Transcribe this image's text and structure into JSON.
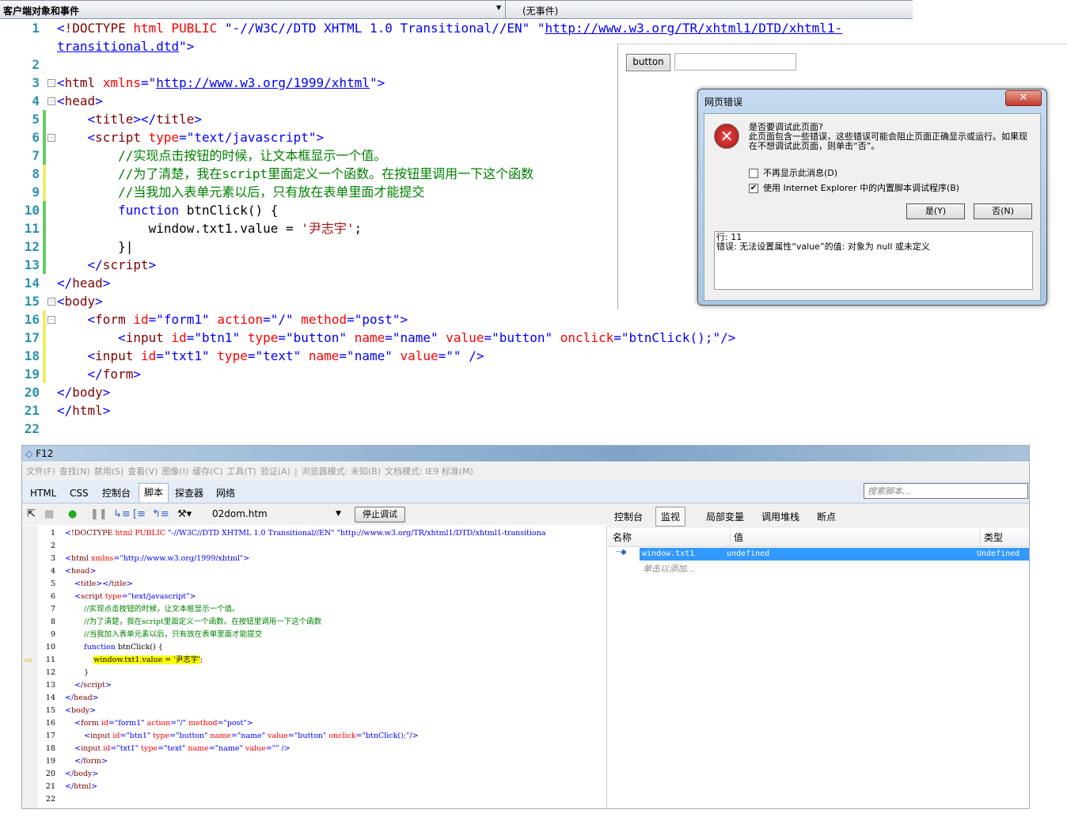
{
  "topbar": {
    "object_select": "客户端对象和事件",
    "event_select": "(无事件)"
  },
  "editor_lines": [
    {
      "n": "1",
      "tokens": [
        [
          "d",
          "<"
        ],
        [
          "tag",
          "!DOCTYPE "
        ],
        [
          "attr",
          "html PUBLIC "
        ],
        [
          "val",
          "\"-//W3C//DTD XHTML 1.0 Transitional//EN\" \""
        ],
        [
          "link",
          "http://www.w3.org/TR/xhtml1/DTD/xhtml1-"
        ]
      ]
    },
    {
      "n": "",
      "tokens": [
        [
          "link",
          "transitional.dtd"
        ],
        [
          "val",
          "\""
        ],
        [
          "d",
          ">"
        ]
      ]
    },
    {
      "n": "2",
      "tokens": []
    },
    {
      "n": "3",
      "fold": "-",
      "tokens": [
        [
          "d",
          "<"
        ],
        [
          "tag",
          "html "
        ],
        [
          "attr",
          "xmlns"
        ],
        [
          "d",
          "=\""
        ],
        [
          "link",
          "http://www.w3.org/1999/xhtml"
        ],
        [
          "d",
          "\">"
        ]
      ]
    },
    {
      "n": "4",
      "fold": "-",
      "tokens": [
        [
          "d",
          "<"
        ],
        [
          "tag",
          "head"
        ],
        [
          "d",
          ">"
        ]
      ]
    },
    {
      "n": "5",
      "chg": "#6c6",
      "tokens": [
        [
          "txt",
          "    "
        ],
        [
          "d",
          "<"
        ],
        [
          "tag",
          "title"
        ],
        [
          "d",
          "></"
        ],
        [
          "tag",
          "title"
        ],
        [
          "d",
          ">"
        ]
      ]
    },
    {
      "n": "6",
      "chg": "#6c6",
      "fold": "-",
      "tokens": [
        [
          "txt",
          "    "
        ],
        [
          "d",
          "<"
        ],
        [
          "tag",
          "script "
        ],
        [
          "attr",
          "type"
        ],
        [
          "d",
          "=\"text/javascript\">"
        ]
      ]
    },
    {
      "n": "7",
      "chg": "#6c6",
      "tokens": [
        [
          "txt",
          "        "
        ],
        [
          "com",
          "//实现点击按钮的时候，让文本框显示一个值。"
        ]
      ]
    },
    {
      "n": "8",
      "chg": "#ee6",
      "tokens": [
        [
          "txt",
          "        "
        ],
        [
          "com",
          "//为了清楚，我在script里面定义一个函数。在按钮里调用一下这个函数"
        ]
      ]
    },
    {
      "n": "9",
      "chg": "#ee6",
      "tokens": [
        [
          "txt",
          "        "
        ],
        [
          "com",
          "//当我加入表单元素以后，只有放在表单里面才能提交"
        ]
      ]
    },
    {
      "n": "10",
      "chg": "#6c6",
      "tokens": [
        [
          "txt",
          "        "
        ],
        [
          "kw",
          "function "
        ],
        [
          "txt",
          "btnClick() {"
        ]
      ]
    },
    {
      "n": "11",
      "chg": "#6c6",
      "tokens": [
        [
          "txt",
          "            window.txt1.value = "
        ],
        [
          "str",
          "'尹志宇'"
        ],
        [
          "txt",
          ";"
        ]
      ]
    },
    {
      "n": "12",
      "chg": "#6c6",
      "tokens": [
        [
          "txt",
          "        }|"
        ]
      ]
    },
    {
      "n": "13",
      "chg": "#6c6",
      "tokens": [
        [
          "txt",
          "    "
        ],
        [
          "d",
          "</"
        ],
        [
          "tag",
          "script"
        ],
        [
          "d",
          ">"
        ]
      ]
    },
    {
      "n": "14",
      "tokens": [
        [
          "d",
          "</"
        ],
        [
          "tag",
          "head"
        ],
        [
          "d",
          ">"
        ]
      ]
    },
    {
      "n": "15",
      "fold": "-",
      "tokens": [
        [
          "d",
          "<"
        ],
        [
          "tag",
          "body"
        ],
        [
          "d",
          ">"
        ]
      ]
    },
    {
      "n": "16",
      "chg": "#ee6",
      "fold": "-",
      "tokens": [
        [
          "txt",
          "    "
        ],
        [
          "d",
          "<"
        ],
        [
          "tag",
          "form "
        ],
        [
          "attr",
          "id"
        ],
        [
          "d",
          "=\"form1\" "
        ],
        [
          "attr",
          "action"
        ],
        [
          "d",
          "=\"/\" "
        ],
        [
          "attr",
          "method"
        ],
        [
          "d",
          "=\"post\">"
        ]
      ]
    },
    {
      "n": "17",
      "chg": "#ee6",
      "tokens": [
        [
          "txt",
          "        "
        ],
        [
          "d",
          "<"
        ],
        [
          "tag",
          "input "
        ],
        [
          "attr",
          "id"
        ],
        [
          "d",
          "=\"btn1\" "
        ],
        [
          "attr",
          "type"
        ],
        [
          "d",
          "=\"button\" "
        ],
        [
          "attr",
          "name"
        ],
        [
          "d",
          "=\"name\" "
        ],
        [
          "attr",
          "value"
        ],
        [
          "d",
          "=\"button\" "
        ],
        [
          "attr",
          "onclick"
        ],
        [
          "d",
          "=\"btnClick();\"/>"
        ]
      ]
    },
    {
      "n": "18",
      "chg": "#ee6",
      "tokens": [
        [
          "txt",
          "    "
        ],
        [
          "d",
          "<"
        ],
        [
          "tag",
          "input "
        ],
        [
          "attr",
          "id"
        ],
        [
          "d",
          "=\"txt1\" "
        ],
        [
          "attr",
          "type"
        ],
        [
          "d",
          "=\"text\" "
        ],
        [
          "attr",
          "name"
        ],
        [
          "d",
          "=\"name\" "
        ],
        [
          "attr",
          "value"
        ],
        [
          "d",
          "=\"\" />"
        ]
      ]
    },
    {
      "n": "19",
      "chg": "#ee6",
      "tokens": [
        [
          "txt",
          "    "
        ],
        [
          "d",
          "</"
        ],
        [
          "tag",
          "form"
        ],
        [
          "d",
          ">"
        ]
      ]
    },
    {
      "n": "20",
      "tokens": [
        [
          "d",
          "</"
        ],
        [
          "tag",
          "body"
        ],
        [
          "d",
          ">"
        ]
      ]
    },
    {
      "n": "21",
      "tokens": [
        [
          "d",
          "</"
        ],
        [
          "tag",
          "html"
        ],
        [
          "d",
          ">"
        ]
      ]
    },
    {
      "n": "22",
      "tokens": []
    }
  ],
  "preview": {
    "button_label": "button",
    "textbox_value": ""
  },
  "dialog": {
    "title": "网页错误",
    "close": "✕",
    "icon": "error-icon",
    "message": "是否要调试此页面?\n此页面包含一些错误，这些错误可能会阻止页面正确显示或运行。如果现在不想调试此页面，则单击“否”。",
    "checkbox1": "不再显示此消息(D)",
    "checkbox1_checked": false,
    "checkbox2": "使用 Internet Explorer 中的内置脚本调试程序(B)",
    "checkbox2_checked": true,
    "yes": "是(Y)",
    "no": "否(N)",
    "log_line": "行: 11",
    "log_error": "错误: 无法设置属性“value”的值: 对象为 null 或未定义"
  },
  "f12": {
    "title": "F12",
    "menu": [
      "文件(F)",
      "查找(N)",
      "禁用(S)",
      "查看(V)",
      "图像(I)",
      "缓存(C)",
      "工具(T)",
      "验证(A)",
      "|",
      "浏览器模式: 未知(B)",
      "文档模式: IE9 标准(M)"
    ],
    "tabs": [
      "HTML",
      "CSS",
      "控制台",
      "脚本",
      "探查器",
      "网络"
    ],
    "active_tab": "脚本",
    "search_placeholder": "搜索脚本...",
    "file": "02dom.htm",
    "stop_debug": "停止调试",
    "current_line": "11",
    "code_lines": [
      {
        "n": "1",
        "tokens": [
          [
            "d",
            "<"
          ],
          [
            "tag",
            "!DOCTYPE "
          ],
          [
            "attr",
            "html PUBLIC "
          ],
          [
            "val",
            "\"-//W3C//DTD XHTML 1.0 Transitional//EN\" \"http://www.w3.org/TR/xhtml1/DTD/xhtml1-transitiona"
          ]
        ]
      },
      {
        "n": "2",
        "tokens": []
      },
      {
        "n": "3",
        "tokens": [
          [
            "d",
            "<"
          ],
          [
            "tag",
            "html "
          ],
          [
            "attr",
            "xmlns"
          ],
          [
            "d",
            "=\"http://www.w3.org/1999/xhtml\">"
          ]
        ]
      },
      {
        "n": "4",
        "tokens": [
          [
            "d",
            "<"
          ],
          [
            "tag",
            "head"
          ],
          [
            "d",
            ">"
          ]
        ]
      },
      {
        "n": "5",
        "tokens": [
          [
            "txt",
            "    "
          ],
          [
            "d",
            "<"
          ],
          [
            "tag",
            "title"
          ],
          [
            "d",
            "></"
          ],
          [
            "tag",
            "title"
          ],
          [
            "d",
            ">"
          ]
        ]
      },
      {
        "n": "6",
        "tokens": [
          [
            "txt",
            "    "
          ],
          [
            "d",
            "<"
          ],
          [
            "tag",
            "script "
          ],
          [
            "attr",
            "type"
          ],
          [
            "d",
            "=\"text/javascript\">"
          ]
        ]
      },
      {
        "n": "7",
        "tokens": [
          [
            "txt",
            "        "
          ],
          [
            "com",
            "//实现点击按钮的时候，让文本框显示一个值。"
          ]
        ]
      },
      {
        "n": "8",
        "tokens": [
          [
            "txt",
            "        "
          ],
          [
            "com",
            "//为了清楚，我在script里面定义一个函数。在按钮里调用一下这个函数"
          ]
        ]
      },
      {
        "n": "9",
        "tokens": [
          [
            "txt",
            "        "
          ],
          [
            "com",
            "//当我加入表单元素以后，只有放在表单里面才能提交"
          ]
        ]
      },
      {
        "n": "10",
        "tokens": [
          [
            "txt",
            "        "
          ],
          [
            "kw",
            "function "
          ],
          [
            "txt",
            "btnClick() {"
          ]
        ]
      },
      {
        "n": "11",
        "tokens": [
          [
            "txt",
            "            "
          ],
          [
            "hl",
            "window.txt1.value = '尹志宇'"
          ],
          [
            "txt",
            ";"
          ]
        ]
      },
      {
        "n": "12",
        "tokens": [
          [
            "txt",
            "        }"
          ]
        ]
      },
      {
        "n": "13",
        "tokens": [
          [
            "txt",
            "    "
          ],
          [
            "d",
            "</"
          ],
          [
            "tag",
            "script"
          ],
          [
            "d",
            ">"
          ]
        ]
      },
      {
        "n": "14",
        "tokens": [
          [
            "d",
            "</"
          ],
          [
            "tag",
            "head"
          ],
          [
            "d",
            ">"
          ]
        ]
      },
      {
        "n": "15",
        "tokens": [
          [
            "d",
            "<"
          ],
          [
            "tag",
            "body"
          ],
          [
            "d",
            ">"
          ]
        ]
      },
      {
        "n": "16",
        "tokens": [
          [
            "txt",
            "    "
          ],
          [
            "d",
            "<"
          ],
          [
            "tag",
            "form "
          ],
          [
            "attr",
            "id"
          ],
          [
            "d",
            "=\"form1\" "
          ],
          [
            "attr",
            "action"
          ],
          [
            "d",
            "=\"/\" "
          ],
          [
            "attr",
            "method"
          ],
          [
            "d",
            "=\"post\">"
          ]
        ]
      },
      {
        "n": "17",
        "tokens": [
          [
            "txt",
            "        "
          ],
          [
            "d",
            "<"
          ],
          [
            "tag",
            "input "
          ],
          [
            "attr",
            "id"
          ],
          [
            "d",
            "=\"btn1\" "
          ],
          [
            "attr",
            "type"
          ],
          [
            "d",
            "=\"button\" "
          ],
          [
            "attr",
            "name"
          ],
          [
            "d",
            "=\"name\" "
          ],
          [
            "attr",
            "value"
          ],
          [
            "d",
            "=\"button\" "
          ],
          [
            "attr",
            "onclick"
          ],
          [
            "d",
            "=\"btnClick();\"/>"
          ]
        ]
      },
      {
        "n": "18",
        "tokens": [
          [
            "txt",
            "    "
          ],
          [
            "d",
            "<"
          ],
          [
            "tag",
            "input "
          ],
          [
            "attr",
            "id"
          ],
          [
            "d",
            "=\"txt1\" "
          ],
          [
            "attr",
            "type"
          ],
          [
            "d",
            "=\"text\" "
          ],
          [
            "attr",
            "name"
          ],
          [
            "d",
            "=\"name\" "
          ],
          [
            "attr",
            "value"
          ],
          [
            "d",
            "=\"\" />"
          ]
        ]
      },
      {
        "n": "19",
        "tokens": [
          [
            "txt",
            "    "
          ],
          [
            "d",
            "</"
          ],
          [
            "tag",
            "form"
          ],
          [
            "d",
            ">"
          ]
        ]
      },
      {
        "n": "20",
        "tokens": [
          [
            "d",
            "</"
          ],
          [
            "tag",
            "body"
          ],
          [
            "d",
            ">"
          ]
        ]
      },
      {
        "n": "21",
        "tokens": [
          [
            "d",
            "</"
          ],
          [
            "tag",
            "html"
          ],
          [
            "d",
            ">"
          ]
        ]
      },
      {
        "n": "22",
        "tokens": []
      }
    ],
    "right_tabs": [
      "控制台",
      "监视",
      "局部变量",
      "调用堆栈",
      "断点"
    ],
    "right_active": "监视",
    "watch": {
      "col_name": "名称",
      "col_value": "值",
      "col_type": "类型",
      "rows": [
        {
          "name": "window.txt1",
          "value": "undefined",
          "type": "Undefined"
        }
      ],
      "add_hint": "单击以添加..."
    }
  }
}
